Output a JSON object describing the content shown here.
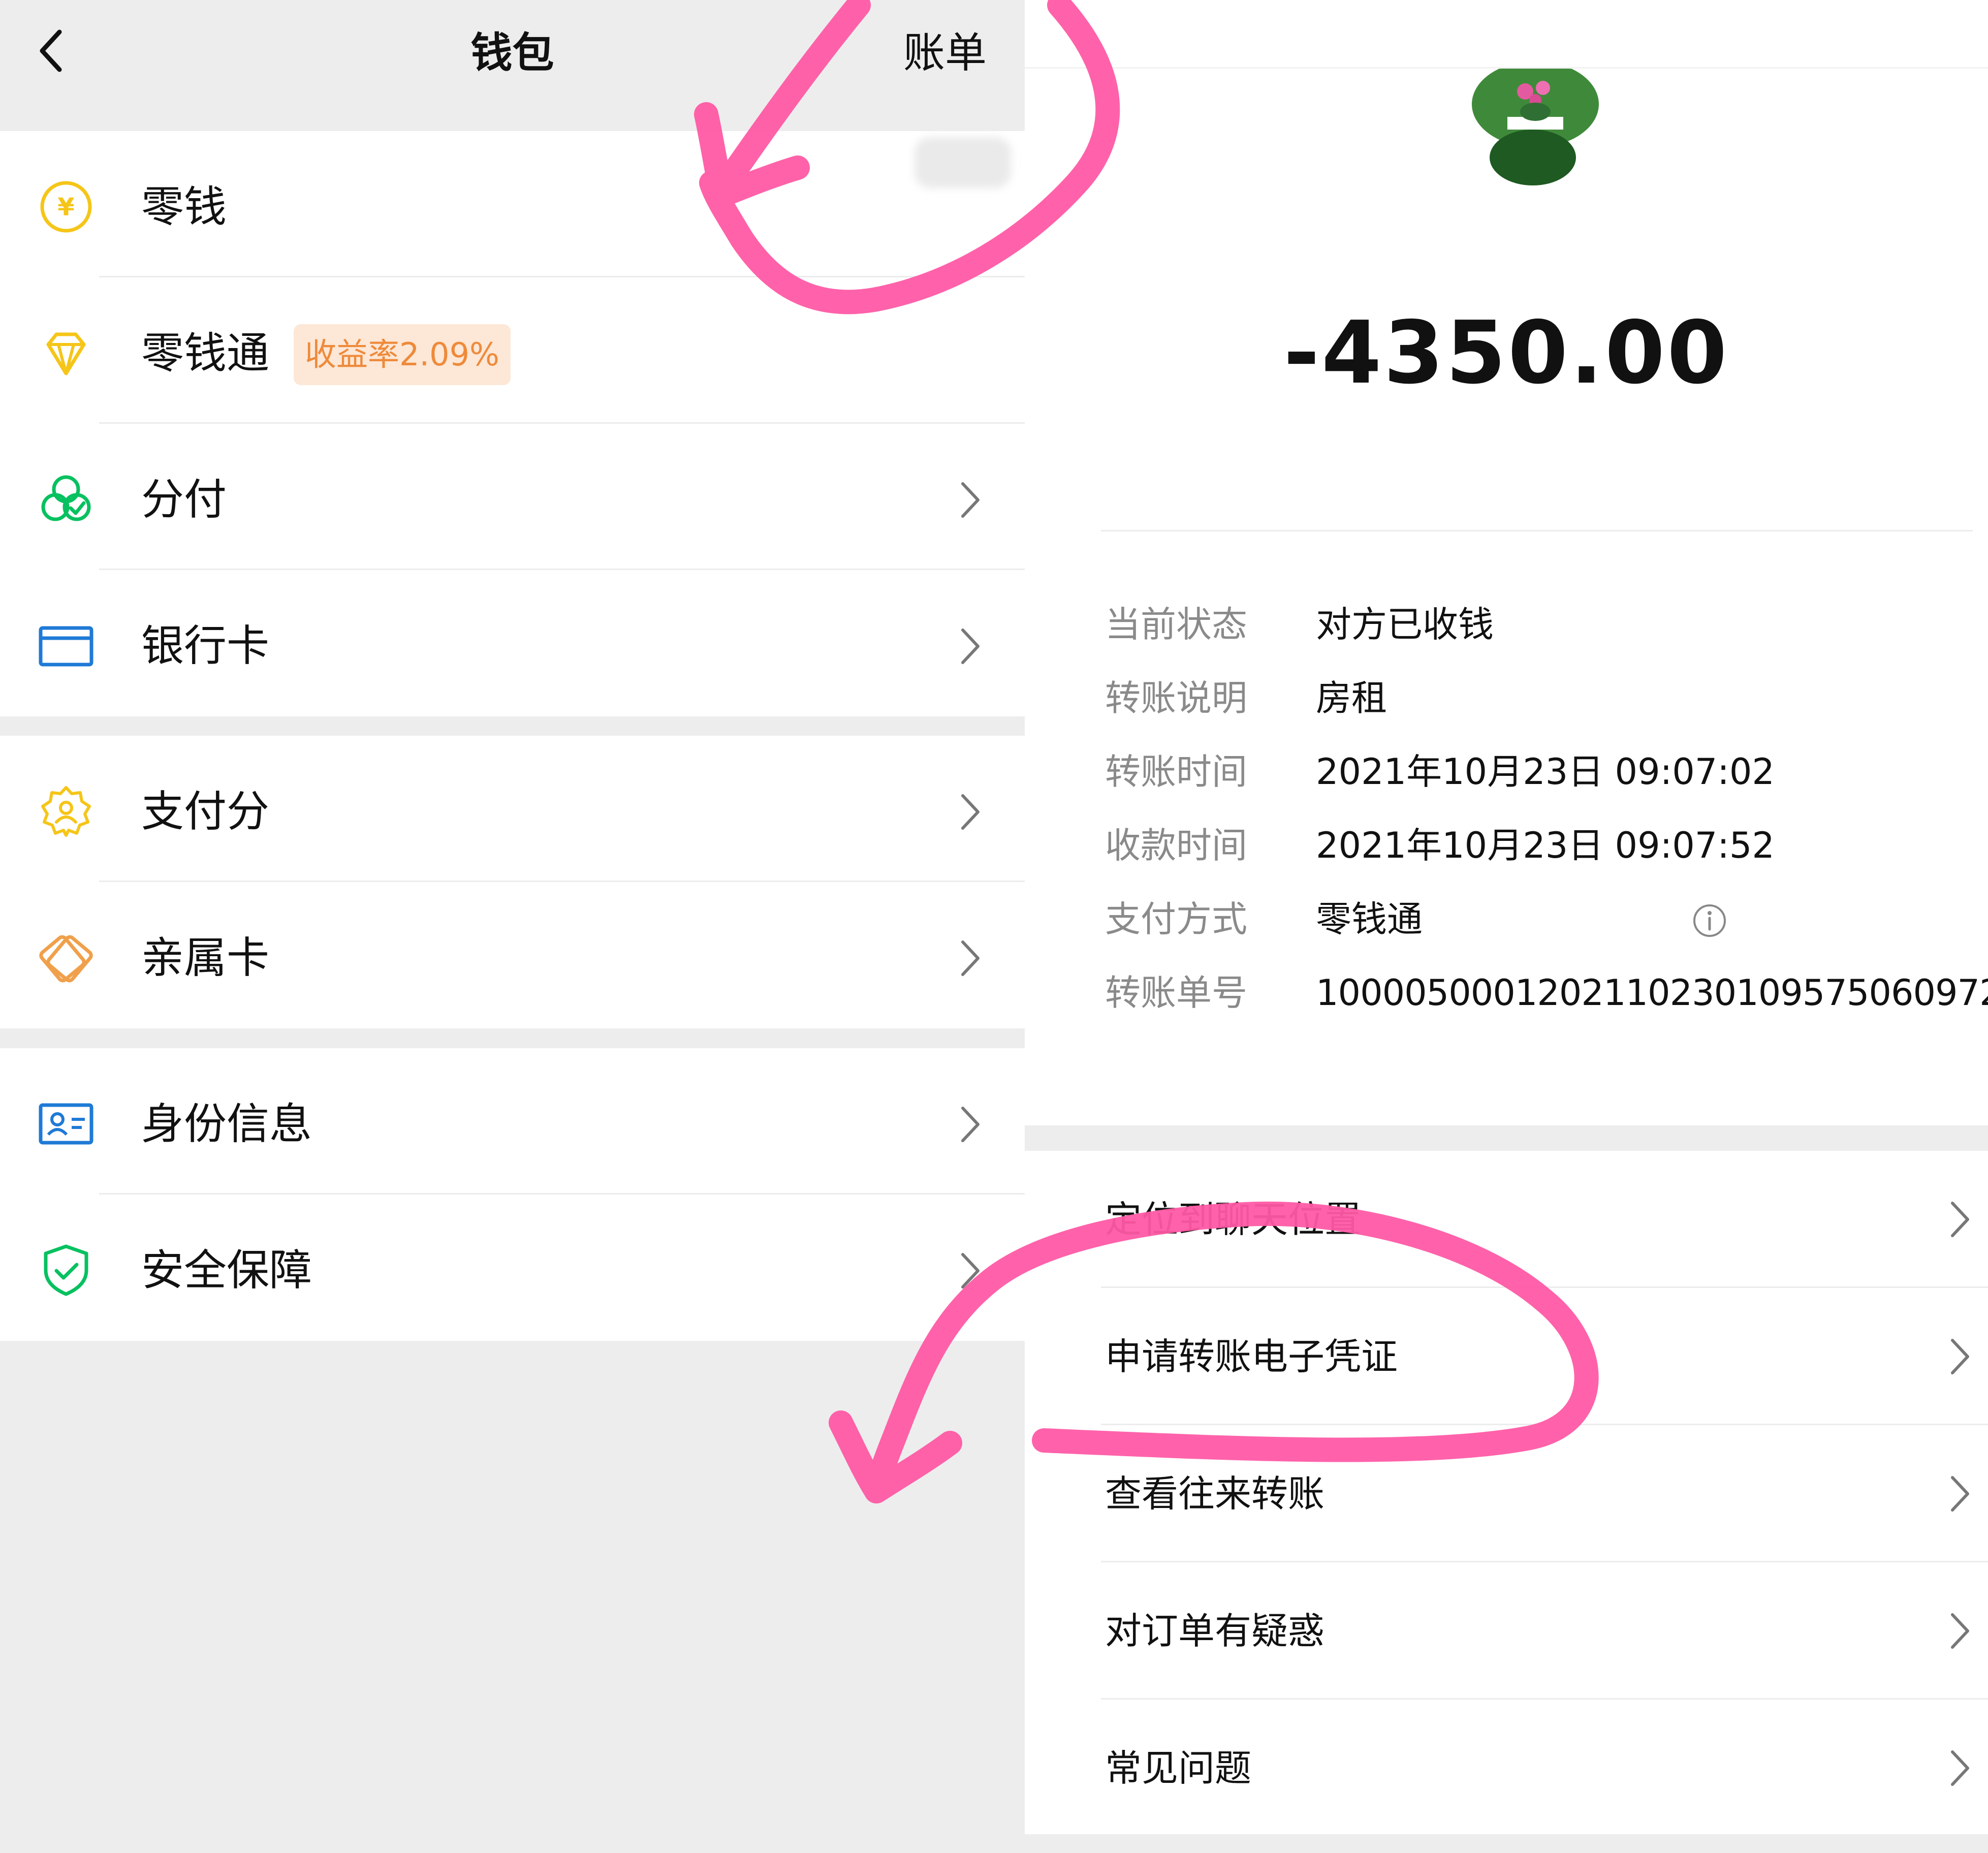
{
  "wallet": {
    "title": "钱包",
    "bill_link": "账单",
    "groups": [
      {
        "items": [
          {
            "label": "零钱",
            "icon": "yuan-coin-icon",
            "badge": null
          },
          {
            "label": "零钱通",
            "icon": "diamond-icon",
            "badge": "收益率2.09%"
          },
          {
            "label": "分付",
            "icon": "fenfu-icon",
            "badge": null
          },
          {
            "label": "银行卡",
            "icon": "bank-card-icon",
            "badge": null
          }
        ]
      },
      {
        "items": [
          {
            "label": "支付分",
            "icon": "payscore-badge-icon"
          },
          {
            "label": "亲属卡",
            "icon": "family-card-icon"
          }
        ]
      },
      {
        "items": [
          {
            "label": "身份信息",
            "icon": "id-card-icon"
          },
          {
            "label": "安全保障",
            "icon": "shield-check-icon"
          }
        ]
      }
    ],
    "colors": {
      "yellow": "#f5c518",
      "green": "#07c160",
      "blue": "#1f7ad6",
      "orange": "#f0a04b"
    }
  },
  "transfer": {
    "amount": "-4350.00",
    "details": [
      {
        "key": "当前状态",
        "value": "对方已收钱"
      },
      {
        "key": "转账说明",
        "value": "房租"
      },
      {
        "key": "转账时间",
        "value": "2021年10月23日 09:07:02"
      },
      {
        "key": "收款时间",
        "value": "2021年10月23日 09:07:52"
      },
      {
        "key": "支付方式",
        "value": "零钱通"
      },
      {
        "key": "转账单号",
        "value": "100005000120211023010957506 0972"
      }
    ],
    "actions": [
      {
        "label": "定位到聊天位置"
      },
      {
        "label": "申请转账电子凭证"
      },
      {
        "label": "查看往来转账"
      },
      {
        "label": "对订单有疑惑"
      },
      {
        "label": "常见问题"
      }
    ]
  },
  "annotation_color": "#ff5aa5"
}
